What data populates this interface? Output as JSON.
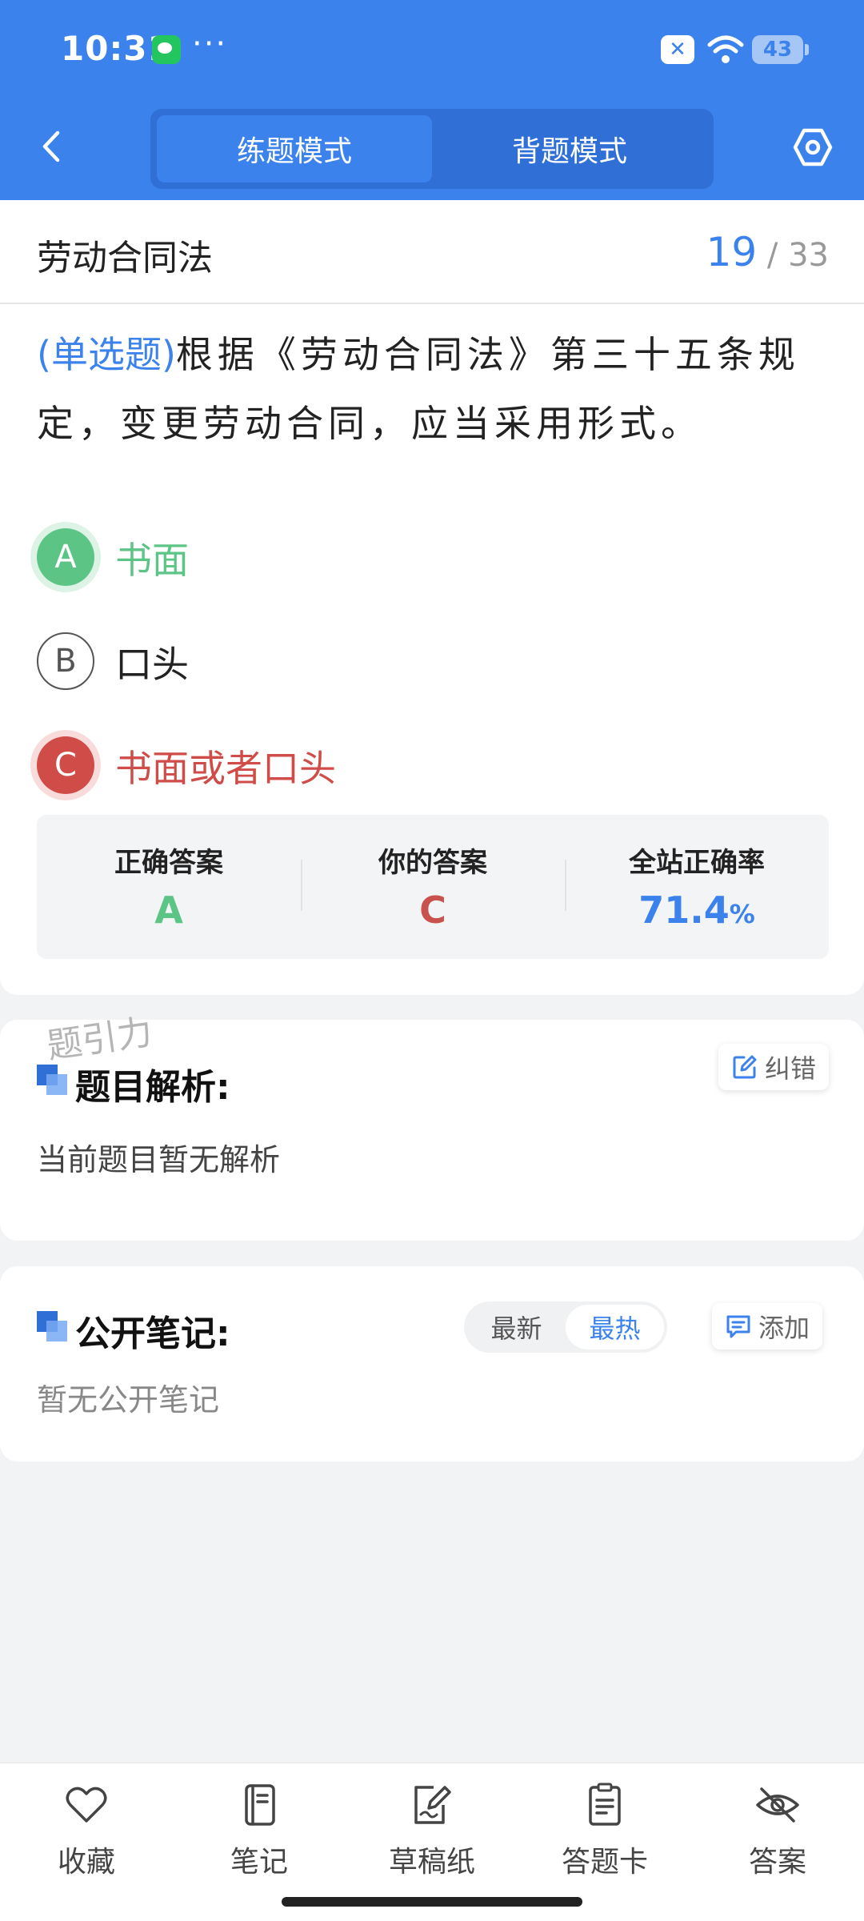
{
  "status_bar": {
    "time": "10:31",
    "dots": "···",
    "battery": "43",
    "colors": {
      "bar_bg": "#3b82ec",
      "correct": "#5cc586",
      "wrong": "#d04c48",
      "accent": "#3b82ec"
    }
  },
  "nav": {
    "tabs": [
      "练题模式",
      "背题模式"
    ],
    "active_tab": "练题模式",
    "icons": [
      "chevron-left-icon",
      "settings-icon"
    ]
  },
  "question": {
    "category": "劳动合同法",
    "index": "19",
    "total": "/ 33",
    "type": "(单选题)",
    "text": "根据《劳动合同法》第三十五条规定，变更劳动合同，应当采用形式。",
    "options": [
      {
        "letter": "A",
        "text": "书面",
        "state": "correct"
      },
      {
        "letter": "B",
        "text": "口头",
        "state": "normal"
      },
      {
        "letter": "C",
        "text": "书面或者口头",
        "state": "wrong"
      }
    ]
  },
  "stats": {
    "correct_label": "正确答案",
    "correct_value": "A",
    "yours_label": "你的答案",
    "yours_value": "C",
    "rate_label": "全站正确率",
    "rate_value": "71.4",
    "rate_unit": "%"
  },
  "analysis": {
    "watermark": "题引力",
    "title": "题目解析:",
    "report_label": "纠错",
    "body": "当前题目暂无解析"
  },
  "notes": {
    "title": "公开笔记:",
    "sort": [
      "最新",
      "最热"
    ],
    "active_sort": "最热",
    "add_label": "添加",
    "body": "暂无公开笔记"
  },
  "bottom_bar": [
    {
      "label": "收藏",
      "icon": "heart-icon"
    },
    {
      "label": "笔记",
      "icon": "notebook-icon"
    },
    {
      "label": "草稿纸",
      "icon": "draft-paper-icon"
    },
    {
      "label": "答题卡",
      "icon": "answer-card-icon"
    },
    {
      "label": "答案",
      "icon": "eye-off-icon"
    }
  ]
}
